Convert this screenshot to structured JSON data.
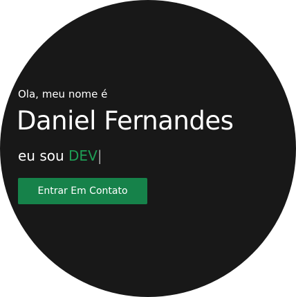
{
  "hero": {
    "greeting": "Ola, meu nome é",
    "name": "Daniel Fernandes",
    "role_prefix": "eu sou ",
    "role_highlight": "DEV",
    "cursor": "|",
    "cta_label": "Entrar Em Contato"
  },
  "colors": {
    "background": "#181818",
    "accent": "#1e9e55",
    "button": "#16824a",
    "text": "#ffffff"
  }
}
